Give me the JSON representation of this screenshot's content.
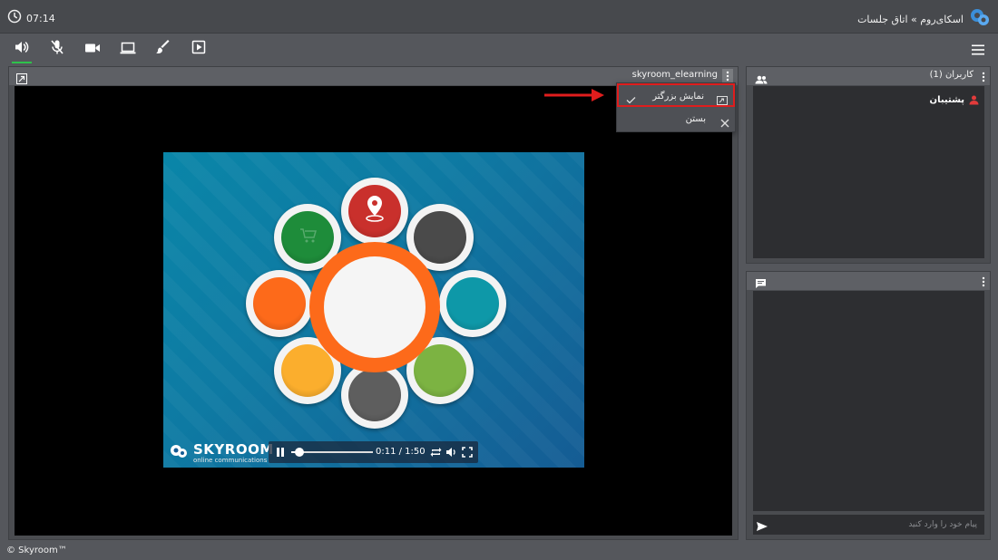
{
  "header": {
    "time": "07:14",
    "breadcrumb": "اسکای‌روم » اتاق جلسات",
    "clock_icon": "clock-icon",
    "logo_icon": "skyroom-logo-icon"
  },
  "toolbar": {
    "items": [
      {
        "name": "speaker-icon",
        "active": true
      },
      {
        "name": "microphone-muted-icon",
        "active": false
      },
      {
        "name": "camera-icon",
        "active": false
      },
      {
        "name": "screen-share-icon",
        "active": false
      },
      {
        "name": "whiteboard-brush-icon",
        "active": false
      },
      {
        "name": "media-play-icon",
        "active": false
      }
    ],
    "menu_icon": "hamburger-menu-icon"
  },
  "main": {
    "user_label": "skyroom_elearning",
    "context_menu": {
      "items": [
        {
          "label": "نمایش بزرگتر",
          "icon": "maximize-icon",
          "checked": true
        },
        {
          "label": "بستن",
          "icon": "close-icon",
          "checked": false
        }
      ]
    },
    "video": {
      "brand": "SKYROOM",
      "tagline": "online communications",
      "time_display": "0:11 / 1:50",
      "progress": 0.1,
      "colors": {
        "top": "#c9302c",
        "top_right": "#4a4a4a",
        "right": "#0e98a8",
        "bottom_right": "#7cb342",
        "bottom": "#5e5e5e",
        "bottom_left": "#fbae2d",
        "left": "#fd6a1a",
        "top_left": "#1e8c3a",
        "center_ring": "#fd6a1a"
      }
    }
  },
  "users_panel": {
    "title": "کاربران (1)",
    "users": [
      {
        "name": "پشتیبان",
        "icon": "user-icon",
        "color": "#e23b3b"
      }
    ]
  },
  "chat": {
    "placeholder": "پیام خود را وارد کنید"
  },
  "footer": {
    "text": "© Skyroom™"
  }
}
